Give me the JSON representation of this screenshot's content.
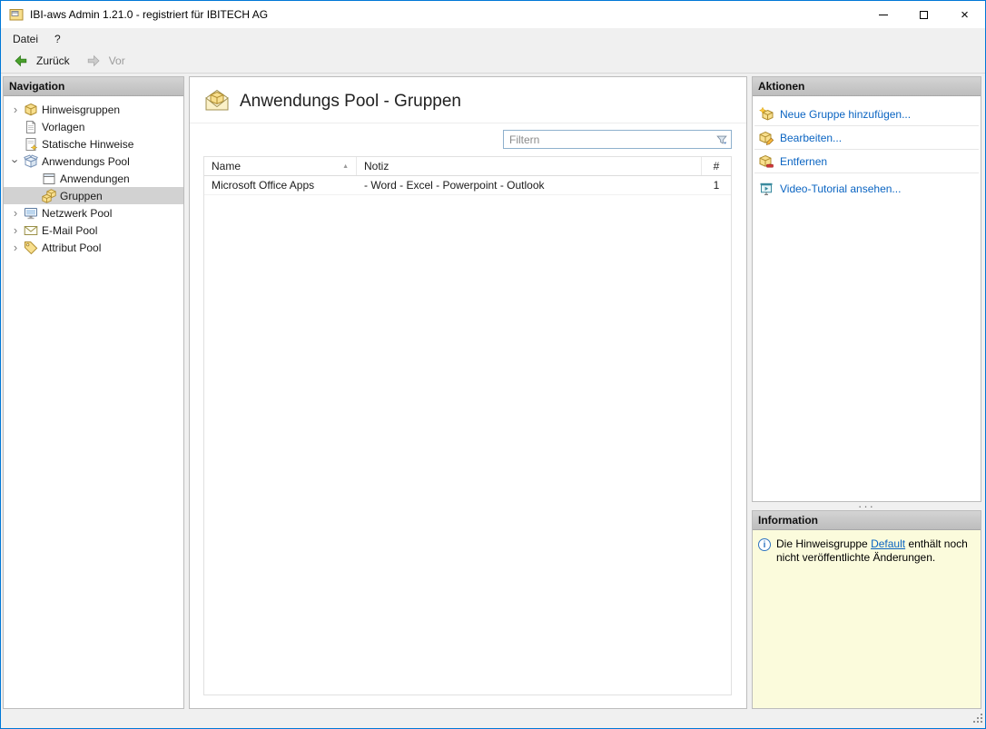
{
  "window": {
    "title": "IBI-aws Admin 1.21.0 - registriert für IBITECH AG"
  },
  "menu": {
    "datei": "Datei",
    "help": "?"
  },
  "toolbar": {
    "back": "Zurück",
    "forward": "Vor"
  },
  "navigation": {
    "header": "Navigation",
    "items": [
      {
        "label": "Hinweisgruppen"
      },
      {
        "label": "Vorlagen"
      },
      {
        "label": "Statische Hinweise"
      },
      {
        "label": "Anwendungs Pool"
      },
      {
        "label": "Anwendungen"
      },
      {
        "label": "Gruppen"
      },
      {
        "label": "Netzwerk Pool"
      },
      {
        "label": "E-Mail Pool"
      },
      {
        "label": "Attribut Pool"
      }
    ]
  },
  "main": {
    "title": "Anwendungs Pool - Gruppen",
    "filter": {
      "placeholder": "Filtern"
    },
    "table": {
      "columns": {
        "name": "Name",
        "notiz": "Notiz",
        "count": "#"
      },
      "rows": [
        {
          "name": "Microsoft Office Apps",
          "notiz": "- Word - Excel - Powerpoint - Outlook",
          "count": "1"
        }
      ]
    }
  },
  "actions": {
    "header": "Aktionen",
    "items": [
      {
        "label": "Neue Gruppe hinzufügen..."
      },
      {
        "label": "Bearbeiten..."
      },
      {
        "label": "Entfernen"
      },
      {
        "label": "Video-Tutorial ansehen..."
      }
    ]
  },
  "information": {
    "header": "Information",
    "text_before": "Die Hinweisgruppe",
    "link": "Default",
    "text_after": "enthält noch nicht veröffentlichte Änderungen."
  },
  "icons": {
    "chevron": "›",
    "sort_asc": "▲",
    "close": "×",
    "splitter": "···",
    "info": "i"
  }
}
